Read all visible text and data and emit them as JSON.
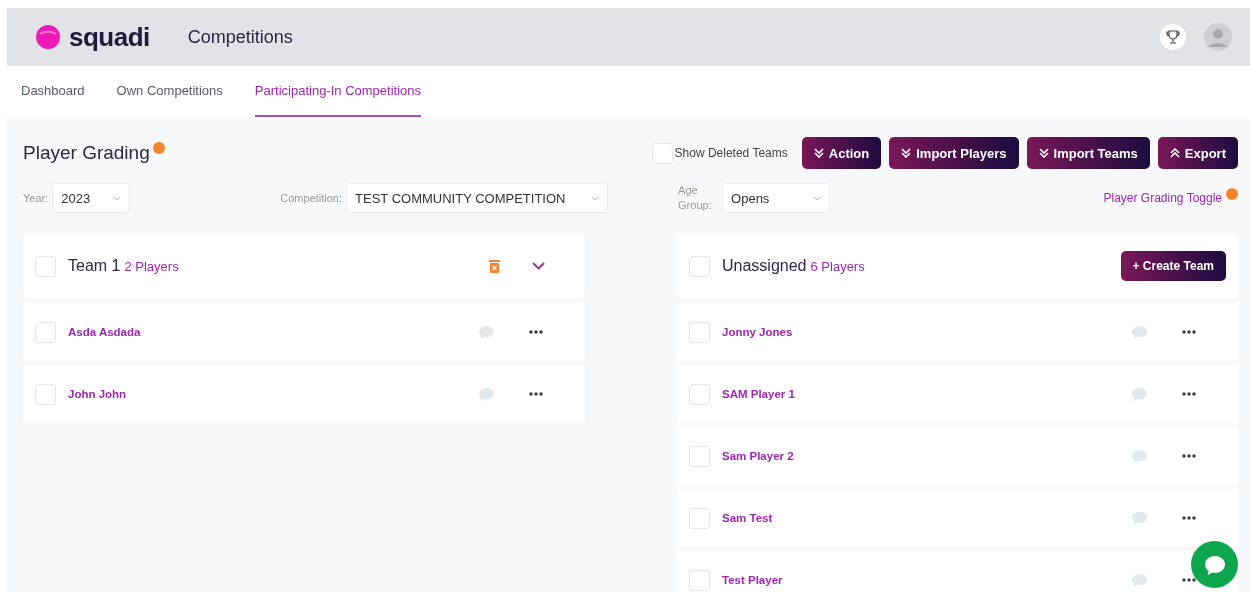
{
  "header": {
    "logo": "squadi",
    "title": "Competitions"
  },
  "tabs": [
    {
      "label": "Dashboard",
      "selected": false
    },
    {
      "label": "Own Competitions",
      "selected": false
    },
    {
      "label": "Participating-In Competitions",
      "selected": true
    }
  ],
  "page_title": "Player Grading",
  "show_deleted": {
    "label": "Show Deleted Teams",
    "checked": false
  },
  "buttons": [
    {
      "label": "Action",
      "kind": "down"
    },
    {
      "label": "Import Players",
      "kind": "down"
    },
    {
      "label": "Import Teams",
      "kind": "down"
    },
    {
      "label": "Export",
      "kind": "up"
    }
  ],
  "filters": {
    "year": {
      "label": "Year:",
      "value": "2023"
    },
    "competition": {
      "label": "Competition:",
      "value": "TEST COMMUNITY COMPETITION"
    },
    "age_group": {
      "label": "Age Group:",
      "value": "Opens"
    }
  },
  "toggle_link": "Player Grading Toggle",
  "teams": [
    {
      "name": "Team 1",
      "count": "2 Players",
      "checked": false,
      "players": [
        {
          "name": "Asda Asdada",
          "checked": false
        },
        {
          "name": "John John",
          "checked": false
        }
      ]
    }
  ],
  "unassigned": {
    "name": "Unassigned",
    "count": "6 Players",
    "checked": false,
    "create_button": "+ Create Team",
    "players": [
      {
        "name": "Jonny Jones",
        "checked": false
      },
      {
        "name": "SAM Player 1",
        "checked": false
      },
      {
        "name": "Sam Player 2",
        "checked": false
      },
      {
        "name": "Sam Test",
        "checked": false
      },
      {
        "name": "Test Player",
        "checked": false
      }
    ]
  }
}
